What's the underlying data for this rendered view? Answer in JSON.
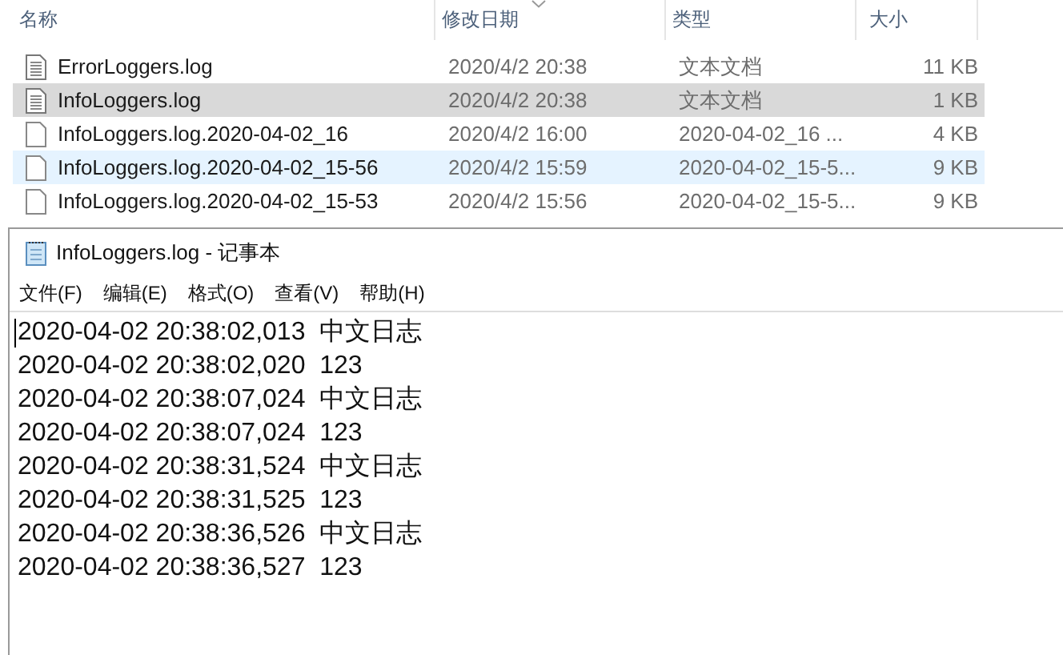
{
  "explorer": {
    "columns": [
      {
        "label": "名称",
        "sorted": false
      },
      {
        "label": "修改日期",
        "sorted": true
      },
      {
        "label": "类型",
        "sorted": false
      },
      {
        "label": "大小",
        "sorted": false
      }
    ],
    "rows": [
      {
        "kind": "text",
        "name": "ErrorLoggers.log",
        "date": "2020/4/2 20:38",
        "type": "文本文档",
        "size": "11 KB",
        "selected": false,
        "hovered": false
      },
      {
        "kind": "text",
        "name": "InfoLoggers.log",
        "date": "2020/4/2 20:38",
        "type": "文本文档",
        "size": "1 KB",
        "selected": true,
        "hovered": false
      },
      {
        "kind": "blank",
        "name": "InfoLoggers.log.2020-04-02_16",
        "date": "2020/4/2 16:00",
        "type": "2020-04-02_16 ...",
        "size": "4 KB",
        "selected": false,
        "hovered": false
      },
      {
        "kind": "blank",
        "name": "InfoLoggers.log.2020-04-02_15-56",
        "date": "2020/4/2 15:59",
        "type": "2020-04-02_15-5...",
        "size": "9 KB",
        "selected": false,
        "hovered": true
      },
      {
        "kind": "blank",
        "name": "InfoLoggers.log.2020-04-02_15-53",
        "date": "2020/4/2 15:56",
        "type": "2020-04-02_15-5...",
        "size": "9 KB",
        "selected": false,
        "hovered": false
      }
    ]
  },
  "notepad": {
    "title": "InfoLoggers.log - 记事本",
    "menu": [
      "文件(F)",
      "编辑(E)",
      "格式(O)",
      "查看(V)",
      "帮助(H)"
    ],
    "lines": [
      "2020-04-02 20:38:02,013  中文日志",
      "2020-04-02 20:38:02,020  123",
      "2020-04-02 20:38:07,024  中文日志",
      "2020-04-02 20:38:07,024  123",
      "2020-04-02 20:38:31,524  中文日志",
      "2020-04-02 20:38:31,525  123",
      "2020-04-02 20:38:36,526  中文日志",
      "2020-04-02 20:38:36,527  123"
    ]
  }
}
